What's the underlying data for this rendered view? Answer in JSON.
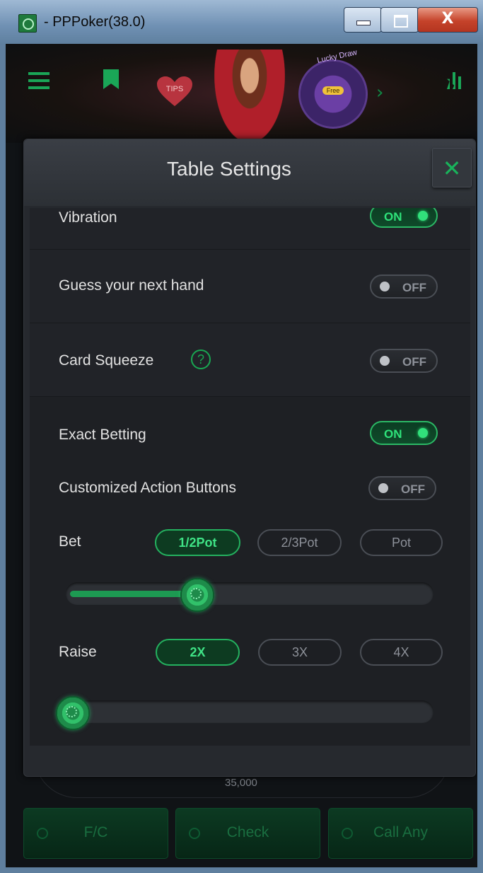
{
  "window": {
    "title": "- PPPoker(38.0)",
    "controls": {
      "close_glyph": "X"
    }
  },
  "topbar": {
    "icons": [
      "menu-icon",
      "bookmark-icon",
      "heart-icon",
      "lucky-draw-wheel",
      "chevron-right-icon",
      "stats-icon"
    ],
    "tips_label": "TIPS",
    "lucky_draw_label": "Lucky Draw",
    "free_label": "Free"
  },
  "settings": {
    "title": "Table Settings",
    "close_glyph": "✕",
    "rows": {
      "vibration": {
        "label": "Vibration",
        "state": "ON"
      },
      "guess_next_hand": {
        "label": "Guess your next hand",
        "state": "OFF"
      },
      "card_squeeze": {
        "label": "Card Squeeze",
        "state": "OFF",
        "help_glyph": "?"
      },
      "exact_betting": {
        "label": "Exact Betting",
        "state": "ON"
      },
      "customized_action_buttons": {
        "label": "Customized Action Buttons",
        "state": "OFF"
      }
    },
    "bet": {
      "label": "Bet",
      "options": [
        "1/2Pot",
        "2/3Pot",
        "Pot"
      ],
      "selected": "1/2Pot",
      "slider_level": 0.36
    },
    "raise": {
      "label": "Raise",
      "options": [
        "2X",
        "3X",
        "4X"
      ],
      "selected": "2X",
      "slider_level": 0.0
    }
  },
  "table": {
    "pot": "35,000",
    "actions": [
      "F/C",
      "Check",
      "Call Any"
    ]
  },
  "colors": {
    "accent": "#19b35b",
    "panel": "#26292e",
    "content": "#1e2024"
  }
}
